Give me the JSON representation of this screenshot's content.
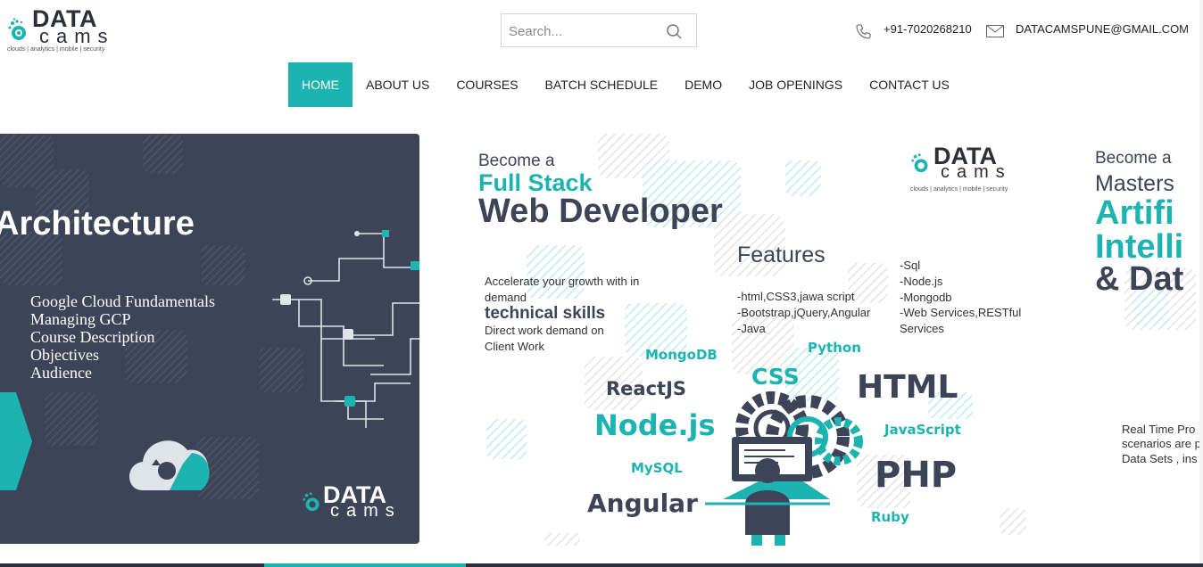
{
  "logo": {
    "word1": "DATA",
    "word2": "cams",
    "tagline": "clouds | analytics | mobile | security"
  },
  "search": {
    "placeholder": "Search..."
  },
  "contact": {
    "phone": "+91-7020268210",
    "email": "DATACAMSPUNE@GMAIL.COM"
  },
  "nav": {
    "items": [
      "HOME",
      "ABOUT US",
      "COURSES",
      "BATCH SCHEDULE",
      "DEMO",
      "JOB OPENINGS",
      "CONTACT US"
    ],
    "active_index": 0
  },
  "colors": {
    "accent": "#1cb3b0",
    "dark": "#3d4457"
  },
  "slide1": {
    "title": "Architecture",
    "items": [
      "Google Cloud Fundamentals",
      "Managing GCP",
      "Course Description",
      "Objectives",
      "Audience"
    ],
    "logo_word1": "DATA",
    "logo_word2": "cams"
  },
  "slide2": {
    "become": "Become a",
    "line1": "Full Stack",
    "line2": "Web Developer",
    "logo_word1": "DATA",
    "logo_word2": "cams",
    "logo_tagline": "clouds | analytics | mobile | security",
    "features_title": "Features",
    "accelerate": "Accelerate your growth with in",
    "demand": "demand",
    "technical": "technical skills",
    "direct": "Direct work demand on",
    "client": "Client Work",
    "features_col1": [
      "-html,CSS3,jawa script",
      "-Bootstrap,jQuery,Angular",
      "-Java"
    ],
    "features_col2": [
      "-Sql",
      "-Node.js",
      "-Mongodb",
      "-Web Services,RESTful",
      "Services"
    ],
    "tags": {
      "mongodb": "MongoDB",
      "python": "Python",
      "reactjs": "ReactJS",
      "css": "CSS",
      "html": "HTML",
      "nodejs": "Node.js",
      "javascript": "JavaScript",
      "mysql": "MySQL",
      "php": "PHP",
      "angular": "Angular",
      "ruby": "Ruby"
    }
  },
  "slide3": {
    "become": "Become a",
    "masters": "Masters",
    "l1": "Artifi",
    "l2": "Intelli",
    "l3": "& Dat",
    "p1": "Real Time Pro",
    "p2": "scenarios are p",
    "p3": "Data Sets , ins"
  }
}
